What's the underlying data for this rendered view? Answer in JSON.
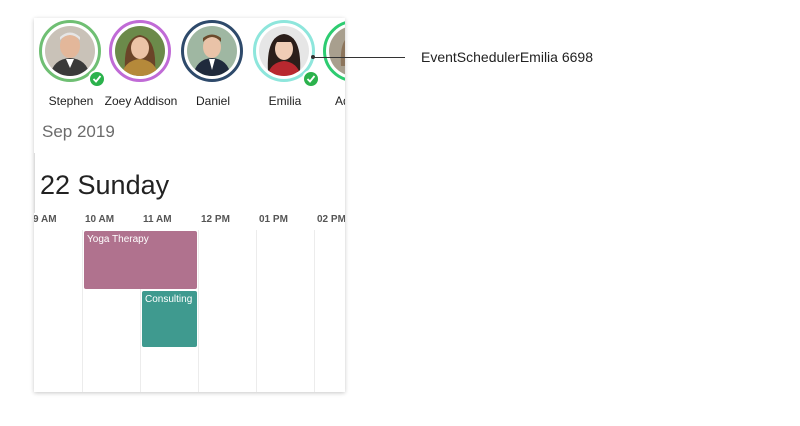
{
  "resources": [
    {
      "name": "Stephen",
      "ring_color": "#6fbf73",
      "checked": true,
      "avatar": "man-avatar"
    },
    {
      "name": "Zoey Addison",
      "ring_color": "#c06bd6",
      "checked": false,
      "avatar": "woman-avatar"
    },
    {
      "name": "Daniel",
      "ring_color": "#2e4a6b",
      "checked": false,
      "avatar": "man-avatar"
    },
    {
      "name": "Emilia",
      "ring_color": "#8ee6dc",
      "checked": true,
      "avatar": "woman-avatar"
    },
    {
      "name": "Adeline",
      "ring_color": "#2ecc71",
      "checked": false,
      "avatar": "woman-avatar"
    }
  ],
  "calendar": {
    "month_label": "Sep 2019",
    "day_label": "22 Sunday",
    "hours": [
      "9 AM",
      "10 AM",
      "11 AM",
      "12 PM",
      "01 PM",
      "02 PM"
    ]
  },
  "events": [
    {
      "title": "Yoga Therapy",
      "color": "#b0728e"
    },
    {
      "title": "Consulting",
      "color": "#3f9a8f"
    }
  ],
  "callout": {
    "label": "EventSchedulerEmilia 6698"
  }
}
